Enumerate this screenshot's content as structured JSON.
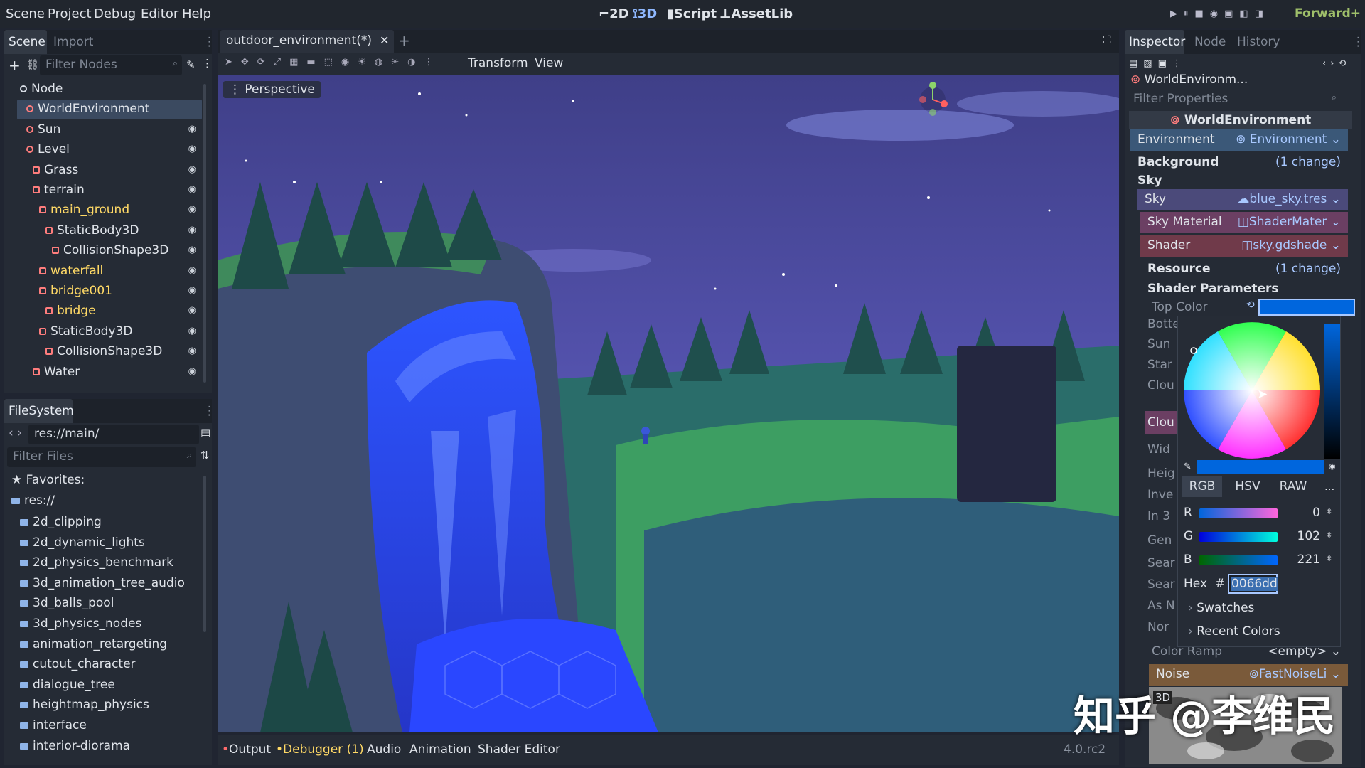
{
  "menus": [
    "Scene",
    "Project",
    "Debug",
    "Editor",
    "Help"
  ],
  "workspaces": [
    {
      "label": "2D",
      "active": false
    },
    {
      "label": "3D",
      "active": true
    },
    {
      "label": "Script",
      "active": false
    },
    {
      "label": "AssetLib",
      "active": false
    }
  ],
  "renderer": "Forward+",
  "scene_dock": {
    "tabs": [
      "Scene",
      "Import"
    ],
    "filter_placeholder": "Filter Nodes",
    "tree": [
      {
        "label": "Node",
        "depth": 0,
        "color": "#e0e4ea"
      },
      {
        "label": "WorldEnvironment",
        "depth": 1,
        "color": "#e0e4ea",
        "selected": true
      },
      {
        "label": "Sun",
        "depth": 1,
        "color": "#e0e4ea"
      },
      {
        "label": "Level",
        "depth": 1,
        "color": "#e0e4ea"
      },
      {
        "label": "Grass",
        "depth": 2,
        "color": "#e0e4ea"
      },
      {
        "label": "terrain",
        "depth": 2,
        "color": "#e0e4ea"
      },
      {
        "label": "main_ground",
        "depth": 3,
        "color": "#ffd966"
      },
      {
        "label": "StaticBody3D",
        "depth": 4,
        "color": "#e0e4ea"
      },
      {
        "label": "CollisionShape3D",
        "depth": 5,
        "color": "#e0e4ea"
      },
      {
        "label": "waterfall",
        "depth": 3,
        "color": "#ffd966"
      },
      {
        "label": "bridge001",
        "depth": 3,
        "color": "#ffd966"
      },
      {
        "label": "bridge",
        "depth": 4,
        "color": "#ffd966"
      },
      {
        "label": "StaticBody3D",
        "depth": 3,
        "color": "#e0e4ea"
      },
      {
        "label": "CollisionShape3D",
        "depth": 4,
        "color": "#e0e4ea"
      },
      {
        "label": "Water",
        "depth": 2,
        "color": "#e0e4ea"
      }
    ]
  },
  "filesystem": {
    "title": "FileSystem",
    "path": "res://main/",
    "filter_placeholder": "Filter Files",
    "favorites": "Favorites:",
    "root": "res://",
    "folders": [
      "2d_clipping",
      "2d_dynamic_lights",
      "2d_physics_benchmark",
      "3d_animation_tree_audio",
      "3d_balls_pool",
      "3d_physics_nodes",
      "animation_retargeting",
      "cutout_character",
      "dialogue_tree",
      "heightmap_physics",
      "interface",
      "interior-diorama"
    ]
  },
  "editor": {
    "tab": "outdoor_environment(*)",
    "menu_transform": "Transform",
    "menu_view": "View",
    "perspective": "Perspective"
  },
  "bottom_bar": {
    "items": [
      "Output",
      "Debugger (1)",
      "Audio",
      "Animation",
      "Shader Editor"
    ],
    "version": "4.0.rc2"
  },
  "inspector": {
    "tabs": [
      "Inspector",
      "Node",
      "History"
    ],
    "object": "WorldEnvironm...",
    "filter_placeholder": "Filter Properties",
    "class_name": "WorldEnvironment",
    "environment_label": "Environment",
    "environment_value": "Environment",
    "background": "Background",
    "background_change": "(1 change)",
    "sky_section": "Sky",
    "sky_label": "Sky",
    "sky_value": "blue_sky.tres",
    "sky_material_label": "Sky Material",
    "sky_material_value": "ShaderMater",
    "shader_label": "Shader",
    "shader_value": "sky.gdshade",
    "resource": "Resource",
    "resource_change": "(1 change)",
    "shader_params": "Shader Parameters",
    "top_color": "Top Color",
    "partial_labels": [
      "Botte",
      "Sun",
      "Star",
      "Clou",
      "Clou",
      "Wid",
      "Heig",
      "Inve",
      "In 3",
      "Gen",
      "Sear",
      "Sear",
      "As N",
      "Nor"
    ],
    "color_ramp_label": "Color Ramp",
    "color_ramp_value": "<empty>",
    "noise_label": "Noise",
    "noise_value": "FastNoiseLi",
    "noise_3d": "3D"
  },
  "color_picker": {
    "modes": [
      "RGB",
      "HSV",
      "RAW"
    ],
    "more": "...",
    "r_label": "R",
    "r_value": "0",
    "g_label": "G",
    "g_value": "102",
    "b_label": "B",
    "b_value": "221",
    "hex_label": "Hex",
    "hash": "#",
    "hex_value": "0066dd",
    "swatches": "Swatches",
    "recent": "Recent Colors",
    "color": "#0066dd"
  },
  "watermark": "知乎 @李维民"
}
